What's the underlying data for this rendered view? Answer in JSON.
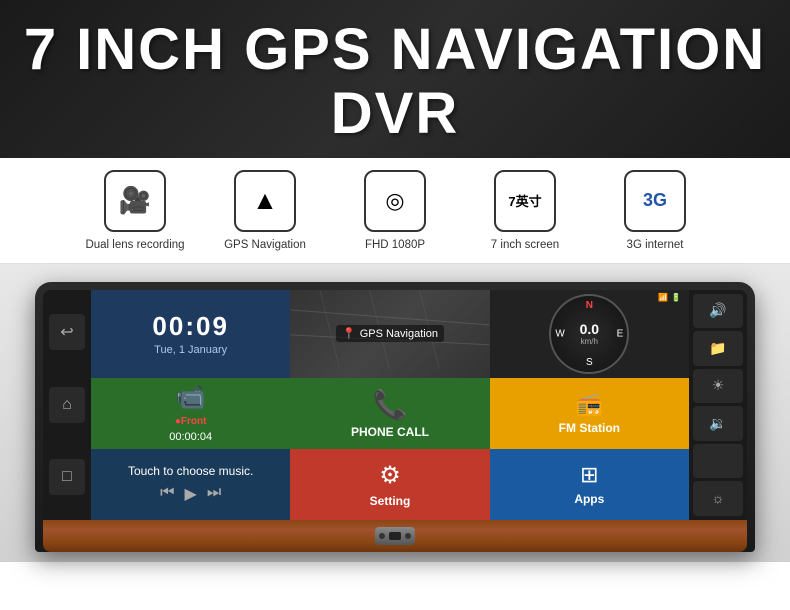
{
  "header": {
    "title": "7 INCH GPS NAVIGATION DVR"
  },
  "features": [
    {
      "id": "dual-lens",
      "icon": "🎥",
      "label": "Dual lens recording"
    },
    {
      "id": "gps-nav",
      "icon": "🧭",
      "label": "GPS Navigation"
    },
    {
      "id": "fhd",
      "icon": "⊙",
      "label": "FHD 1080P"
    },
    {
      "id": "screen-size",
      "icon": "7英寸",
      "label": "7 inch screen",
      "is_text_icon": true
    },
    {
      "id": "3g",
      "icon": "3G",
      "label": "3G internet",
      "is_text_icon": true
    }
  ],
  "device": {
    "screen": {
      "time": "00:09",
      "date": "Tue, 1 January",
      "gps_label": "GPS Navigation",
      "speed": "0.0",
      "speed_unit": "km/h",
      "compass_directions": [
        "N",
        "E",
        "S",
        "W"
      ],
      "record_dot": "●Front",
      "record_time": "00:00:04",
      "phone_label": "PHONE CALL",
      "fm_label": "FM Station",
      "music_text": "Touch to choose music.",
      "setting_label": "Setting",
      "apps_label": "Apps"
    }
  },
  "icons": {
    "back": "↩",
    "home": "⌂",
    "recent": "□",
    "volume_up": "🔊",
    "volume_down": "🔉",
    "brightness_up": "☀",
    "brightness_down": "☼",
    "folder": "📁",
    "prev": "⏮",
    "play": "▶",
    "next": "⏭",
    "gear": "⚙",
    "apps_grid": "⊞",
    "phone": "📞",
    "wifi": "📶",
    "camera_rec": "📹"
  }
}
